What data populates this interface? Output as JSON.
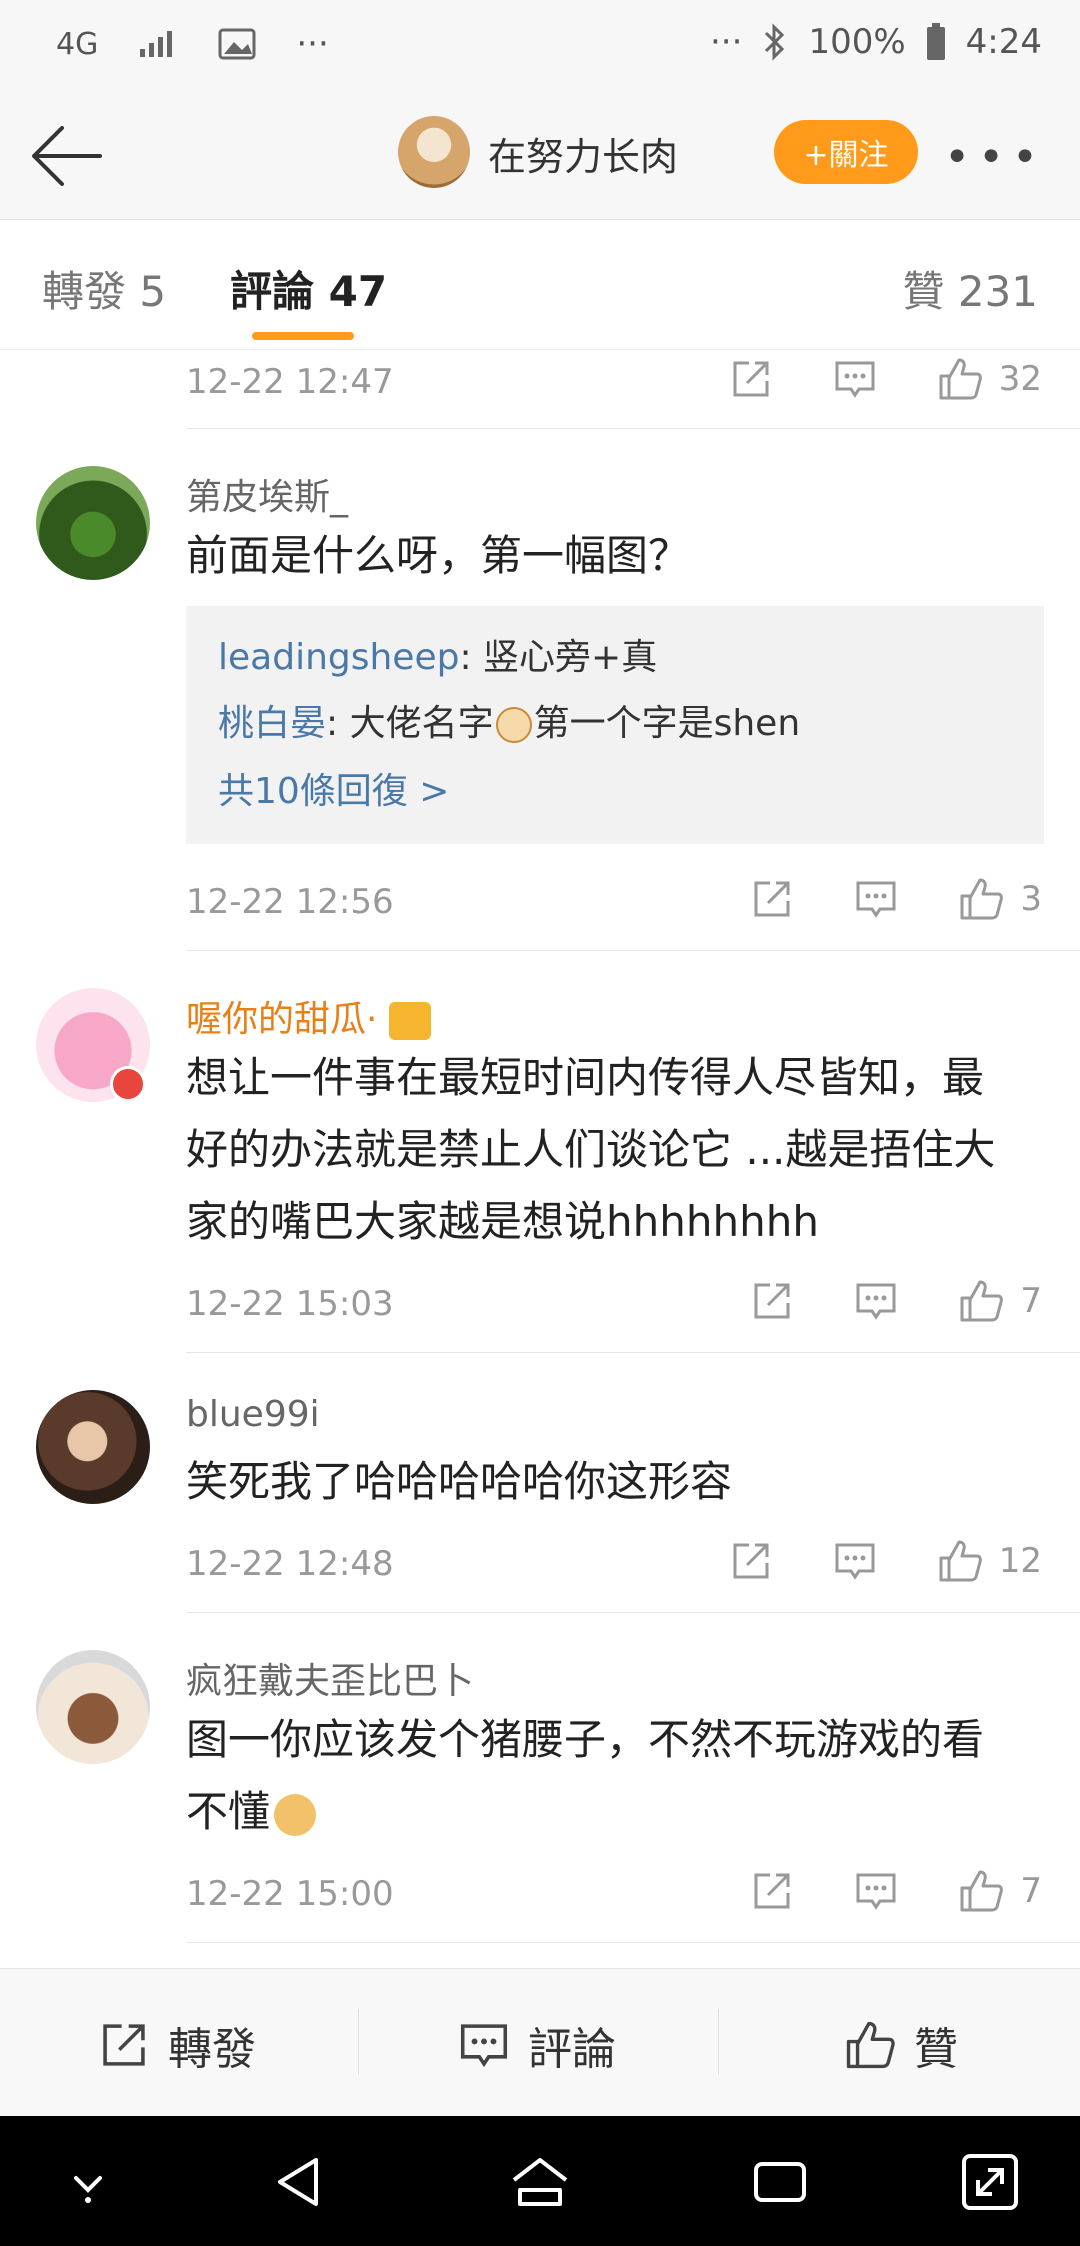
{
  "status_bar": {
    "network": "4G",
    "signal": "signal-icon",
    "image_icon": "image-icon",
    "dots": "···",
    "dots_right": "···",
    "battery_percent": "100%",
    "time": "4:24"
  },
  "top_bar": {
    "name": "在努力长肉",
    "follow_label": "+關注",
    "more_label": "•••"
  },
  "tabs": {
    "forward": "轉發 5",
    "comments": "評論 47",
    "likes": "贊 231"
  },
  "comments": [
    {
      "timestamp": "12-22 12:47",
      "likes": "32"
    },
    {
      "username": "第皮埃斯_",
      "text": "前面是什么呀，第一幅图？",
      "replies": [
        {
          "name": "leadingsheep",
          "text": ": 竖心旁+真"
        },
        {
          "name": "桃白晏",
          "text": ": 大佬名字",
          "text2": "第一个字是shen"
        }
      ],
      "more_replies": "共10條回復 >",
      "timestamp": "12-22 12:56",
      "likes": "3"
    },
    {
      "username": "喔你的甜瓜·",
      "text_line1": "想让一件事在最短时间内传得人尽皆知，最",
      "text_line2": "好的办法就是禁止人们谈论它 ...越是捂住大",
      "text_line3": "家的嘴巴大家越是想说hhhhhhhh",
      "timestamp": "12-22 15:03",
      "likes": "7"
    },
    {
      "username": "blue99i",
      "text": "笑死我了哈哈哈哈哈你这形容",
      "timestamp": "12-22 12:48",
      "likes": "12"
    },
    {
      "username": "疯狂戴夫歪比巴卜",
      "text_line1": "图一你应该发个猪腰子，不然不玩游戏的看",
      "text_line2": "不懂",
      "timestamp": "12-22 15:00",
      "likes": "7"
    }
  ],
  "bottom_bar": {
    "forward": "轉發",
    "comment": "評論",
    "like": "贊"
  },
  "colors": {
    "accent": "#ff9a1a",
    "link": "#4a78a8",
    "vip_name": "#e8801a"
  }
}
